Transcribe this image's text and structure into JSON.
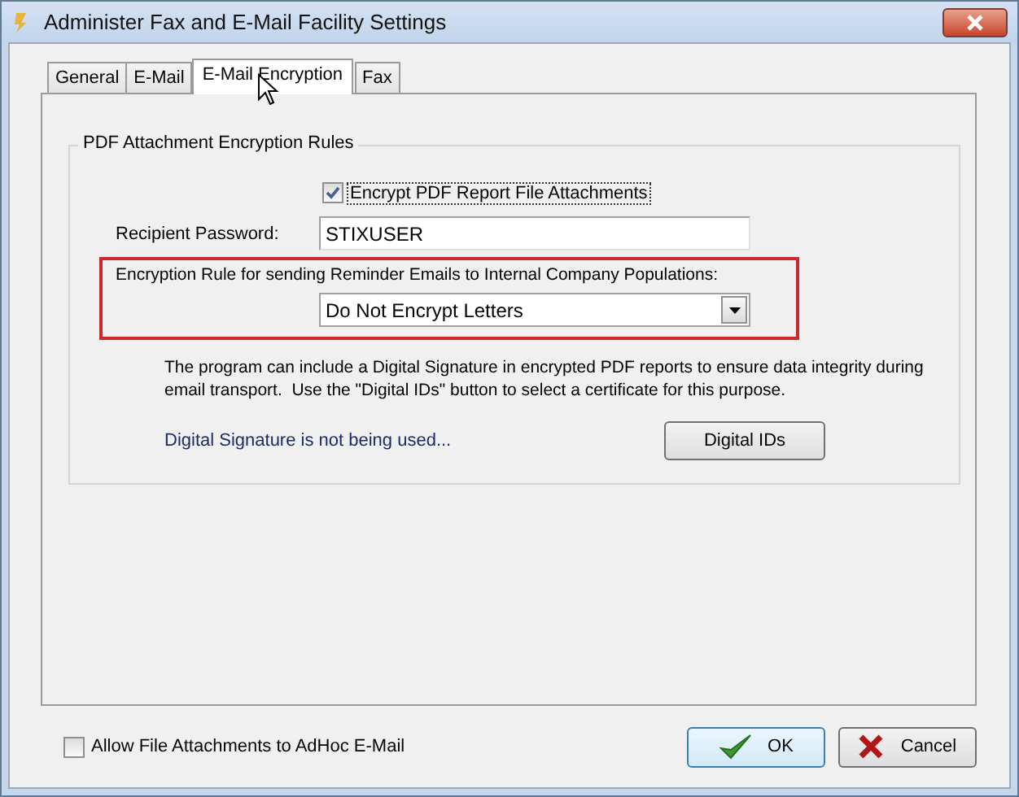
{
  "window": {
    "title": "Administer Fax and E-Mail Facility Settings"
  },
  "tabs": [
    {
      "label": "General",
      "selected": false
    },
    {
      "label": "E-Mail",
      "selected": false
    },
    {
      "label": "E-Mail Encryption",
      "selected": true
    },
    {
      "label": "Fax",
      "selected": false
    }
  ],
  "group": {
    "title": "PDF Attachment Encryption Rules",
    "encrypt_checkbox": {
      "label": "Encrypt PDF Report File Attachments",
      "checked": true
    },
    "password": {
      "label": "Recipient Password:",
      "value": "STIXUSER"
    },
    "rule": {
      "label": "Encryption Rule for sending Reminder Emails to Internal Company Populations:",
      "value": "Do Not Encrypt Letters"
    },
    "description": "The program can include a Digital Signature in encrypted PDF reports to ensure data integrity during email transport.  Use the \"Digital IDs\" button to select a certificate for this purpose.",
    "signature_status": "Digital Signature is not being used...",
    "digital_ids_button": "Digital IDs"
  },
  "attachments_checkbox": {
    "label": "Allow File Attachments to AdHoc E-Mail",
    "checked": false
  },
  "buttons": [
    {
      "label": "OK",
      "kind": "ok"
    },
    {
      "label": "Cancel",
      "kind": "cancel"
    }
  ]
}
